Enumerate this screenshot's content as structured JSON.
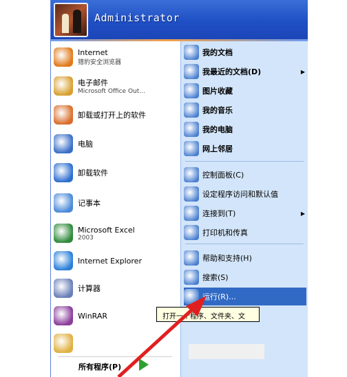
{
  "user": {
    "name": "Administrator"
  },
  "left_items": [
    {
      "title": "Internet",
      "subtitle": "猎豹安全浏览器",
      "icon": "browser-icon",
      "color": "#e07a1a"
    },
    {
      "title": "电子邮件",
      "subtitle": "Microsoft Office Out...",
      "icon": "mail-icon",
      "color": "#d8a030"
    },
    {
      "title": "卸载或打开上的软件",
      "subtitle": "",
      "icon": "app-icon",
      "color": "#d96d2b"
    },
    {
      "title": "电脑",
      "subtitle": "",
      "icon": "computer-icon",
      "color": "#3a6fc7"
    },
    {
      "title": "卸载软件",
      "subtitle": "",
      "icon": "uninstall-icon",
      "color": "#2f6fd0"
    },
    {
      "title": "记事本",
      "subtitle": "",
      "icon": "notepad-icon",
      "color": "#4b8ad8"
    },
    {
      "title": "Microsoft Excel",
      "subtitle": "2003",
      "icon": "excel-icon",
      "color": "#2f8a3c"
    },
    {
      "title": "Internet Explorer",
      "subtitle": "",
      "icon": "ie-icon",
      "color": "#2b7fd9"
    },
    {
      "title": "计算器",
      "subtitle": "",
      "icon": "calculator-icon",
      "color": "#6a7fb8"
    },
    {
      "title": "WinRAR",
      "subtitle": "",
      "icon": "winrar-icon",
      "color": "#8a3d9a"
    },
    {
      "title": "",
      "subtitle": "",
      "icon": "folder-icon",
      "color": "#e0b040"
    }
  ],
  "all_programs": "所有程序(P)",
  "right_items": [
    {
      "label": "我的文档",
      "icon": "documents-folder-icon",
      "bold": true,
      "arrow": false
    },
    {
      "label": "我最近的文档(D)",
      "icon": "recent-documents-icon",
      "bold": true,
      "arrow": true
    },
    {
      "label": "图片收藏",
      "icon": "pictures-folder-icon",
      "bold": true,
      "arrow": false
    },
    {
      "label": "我的音乐",
      "icon": "music-folder-icon",
      "bold": true,
      "arrow": false
    },
    {
      "label": "我的电脑",
      "icon": "my-computer-icon",
      "bold": true,
      "arrow": false
    },
    {
      "label": "网上邻居",
      "icon": "network-icon",
      "bold": true,
      "arrow": false
    },
    {
      "label": "控制面板(C)",
      "icon": "control-panel-icon",
      "bold": false,
      "arrow": false
    },
    {
      "label": "设定程序访问和默认值",
      "icon": "program-defaults-icon",
      "bold": false,
      "arrow": false
    },
    {
      "label": "连接到(T)",
      "icon": "connect-icon",
      "bold": false,
      "arrow": true
    },
    {
      "label": "打印机和传真",
      "icon": "printer-icon",
      "bold": false,
      "arrow": false
    },
    {
      "label": "帮助和支持(H)",
      "icon": "help-icon",
      "bold": false,
      "arrow": false
    },
    {
      "label": "搜索(S)",
      "icon": "search-icon",
      "bold": false,
      "arrow": false
    },
    {
      "label": "运行(R)...",
      "icon": "run-icon",
      "bold": false,
      "arrow": false
    }
  ],
  "tooltip": "打开一个程序、文件夹、文",
  "colors": {
    "header": "#245edb",
    "right_panel": "#d3e5fa",
    "highlight": "#316ac5",
    "arrow": "#e02020"
  }
}
